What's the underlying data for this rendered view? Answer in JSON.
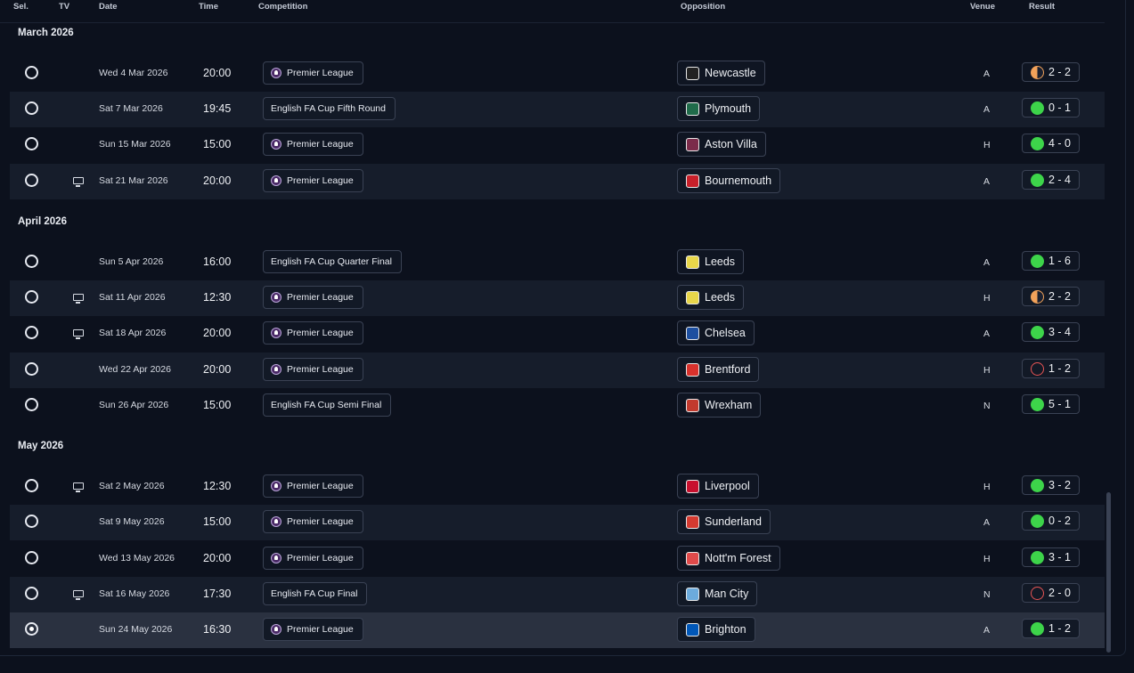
{
  "headers": {
    "sel": "Sel.",
    "tv": "TV",
    "date": "Date",
    "time": "Time",
    "competition": "Competition",
    "opposition": "Opposition",
    "venue": "Venue",
    "result": "Result"
  },
  "months": [
    {
      "label": "March 2026",
      "rows": [
        {
          "selected": false,
          "tv": false,
          "date": "Wed 4 Mar 2026",
          "time": "20:00",
          "competition": "Premier League",
          "pl": true,
          "opposition": "Newcastle",
          "badge": "#222222",
          "venue": "A",
          "outcome": "D",
          "score": "2 - 2"
        },
        {
          "selected": false,
          "tv": false,
          "date": "Sat 7 Mar 2026",
          "time": "19:45",
          "competition": "English FA Cup Fifth Round",
          "pl": false,
          "opposition": "Plymouth",
          "badge": "#1f6b4a",
          "venue": "A",
          "outcome": "W",
          "score": "0 - 1"
        },
        {
          "selected": false,
          "tv": false,
          "date": "Sun 15 Mar 2026",
          "time": "15:00",
          "competition": "Premier League",
          "pl": true,
          "opposition": "Aston Villa",
          "badge": "#7b2b4a",
          "venue": "H",
          "outcome": "W",
          "score": "4 - 0"
        },
        {
          "selected": false,
          "tv": true,
          "date": "Sat 21 Mar 2026",
          "time": "20:00",
          "competition": "Premier League",
          "pl": true,
          "opposition": "Bournemouth",
          "badge": "#c8202a",
          "venue": "A",
          "outcome": "W",
          "score": "2 - 4"
        }
      ]
    },
    {
      "label": "April 2026",
      "rows": [
        {
          "selected": false,
          "tv": false,
          "date": "Sun 5 Apr 2026",
          "time": "16:00",
          "competition": "English FA Cup Quarter Final",
          "pl": false,
          "opposition": "Leeds",
          "badge": "#e8d64a",
          "venue": "A",
          "outcome": "W",
          "score": "1 - 6"
        },
        {
          "selected": false,
          "tv": true,
          "date": "Sat 11 Apr 2026",
          "time": "12:30",
          "competition": "Premier League",
          "pl": true,
          "opposition": "Leeds",
          "badge": "#e8d64a",
          "venue": "H",
          "outcome": "D",
          "score": "2 - 2"
        },
        {
          "selected": false,
          "tv": true,
          "date": "Sat 18 Apr 2026",
          "time": "20:00",
          "competition": "Premier League",
          "pl": true,
          "opposition": "Chelsea",
          "badge": "#1d4fa0",
          "venue": "A",
          "outcome": "W",
          "score": "3 - 4"
        },
        {
          "selected": false,
          "tv": false,
          "date": "Wed 22 Apr 2026",
          "time": "20:00",
          "competition": "Premier League",
          "pl": true,
          "opposition": "Brentford",
          "badge": "#d8312c",
          "venue": "H",
          "outcome": "L",
          "score": "1 - 2"
        },
        {
          "selected": false,
          "tv": false,
          "date": "Sun 26 Apr 2026",
          "time": "15:00",
          "competition": "English FA Cup Semi Final",
          "pl": false,
          "opposition": "Wrexham",
          "badge": "#c23a2e",
          "venue": "N",
          "outcome": "W",
          "score": "5 - 1"
        }
      ]
    },
    {
      "label": "May 2026",
      "rows": [
        {
          "selected": false,
          "tv": true,
          "date": "Sat 2 May 2026",
          "time": "12:30",
          "competition": "Premier League",
          "pl": true,
          "opposition": "Liverpool",
          "badge": "#c8102e",
          "venue": "H",
          "outcome": "W",
          "score": "3 - 2"
        },
        {
          "selected": false,
          "tv": false,
          "date": "Sat 9 May 2026",
          "time": "15:00",
          "competition": "Premier League",
          "pl": true,
          "opposition": "Sunderland",
          "badge": "#d43a30",
          "venue": "A",
          "outcome": "W",
          "score": "0 - 2"
        },
        {
          "selected": false,
          "tv": false,
          "date": "Wed 13 May 2026",
          "time": "20:00",
          "competition": "Premier League",
          "pl": true,
          "opposition": "Nott'm Forest",
          "badge": "#e04a4a",
          "venue": "H",
          "outcome": "W",
          "score": "3 - 1"
        },
        {
          "selected": false,
          "tv": true,
          "date": "Sat 16 May 2026",
          "time": "17:30",
          "competition": "English FA Cup Final",
          "pl": false,
          "opposition": "Man City",
          "badge": "#6cabdd",
          "venue": "N",
          "outcome": "L",
          "score": "2 - 0"
        },
        {
          "selected": true,
          "tv": false,
          "date": "Sun 24 May 2026",
          "time": "16:30",
          "competition": "Premier League",
          "pl": true,
          "opposition": "Brighton",
          "badge": "#0057b8",
          "venue": "A",
          "outcome": "W",
          "score": "1 - 2"
        }
      ]
    }
  ]
}
